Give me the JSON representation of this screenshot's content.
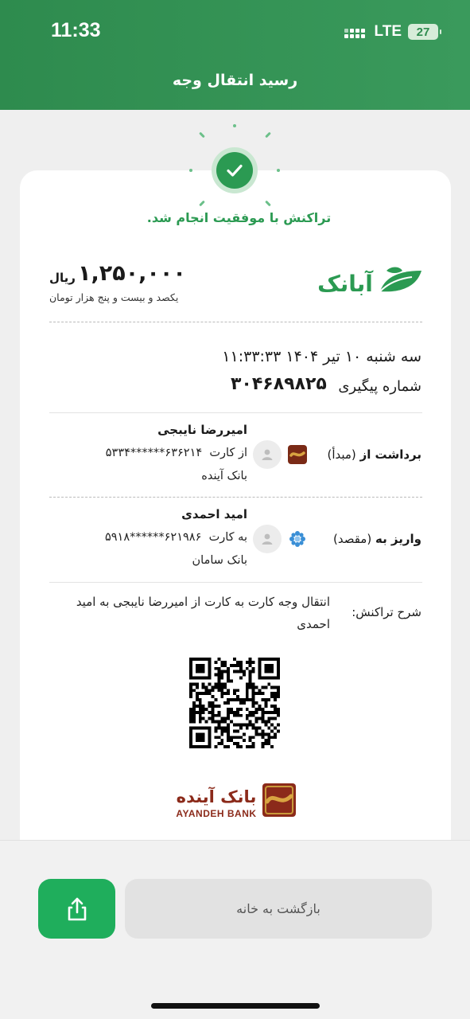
{
  "status_bar": {
    "time": "11:33",
    "network": "LTE",
    "battery": "27"
  },
  "header": {
    "title": "رسید انتقال وجه"
  },
  "receipt": {
    "success_message": "تراکنش با موفقیت انجام شد.",
    "amount": "۱,۲۵۰,۰۰۰",
    "amount_unit": "ریال",
    "amount_words": "یکصد و بیست و پنج هزار تومان",
    "datetime": "سه شنبه ۱۰ تیر ۱۴۰۴  ۱۱:۳۳:۳۳",
    "tracking_label": "شماره پیگیری",
    "tracking_number": "۳۰۴۶۸۹۸۲۵",
    "source": {
      "label_bold": "برداشت از",
      "label_rest": "(مبدأ)",
      "name": "امیررضا نایبجی",
      "card_prefix": "از کارت",
      "card_number": "۶۳۶۲۱۴******۵۳۳۴",
      "bank": "بانک آینده"
    },
    "destination": {
      "label_bold": "واریز به",
      "label_rest": "(مقصد)",
      "name": "امید احمدی",
      "card_prefix": "به کارت",
      "card_number": "۶۲۱۹۸۶******۵۹۱۸",
      "bank": "بانک سامان"
    },
    "description_label": "شرح تراکنش:",
    "description": "انتقال وجه کارت به کارت از امیررضا نایبجی به امید احمدی",
    "brand_logo_text": "آبانک",
    "bank_logo_fa": "بانک آینده",
    "bank_logo_en": "AYANDEH BANK"
  },
  "actions": {
    "home_label": "بازگشت به خانه",
    "share_icon": "share-icon"
  },
  "colors": {
    "primary": "#2e8b4e",
    "success": "#2b9a52",
    "button": "#1fae5c",
    "ayandeh_brown": "#8b2a1a",
    "ayandeh_gold": "#c99a3a"
  }
}
